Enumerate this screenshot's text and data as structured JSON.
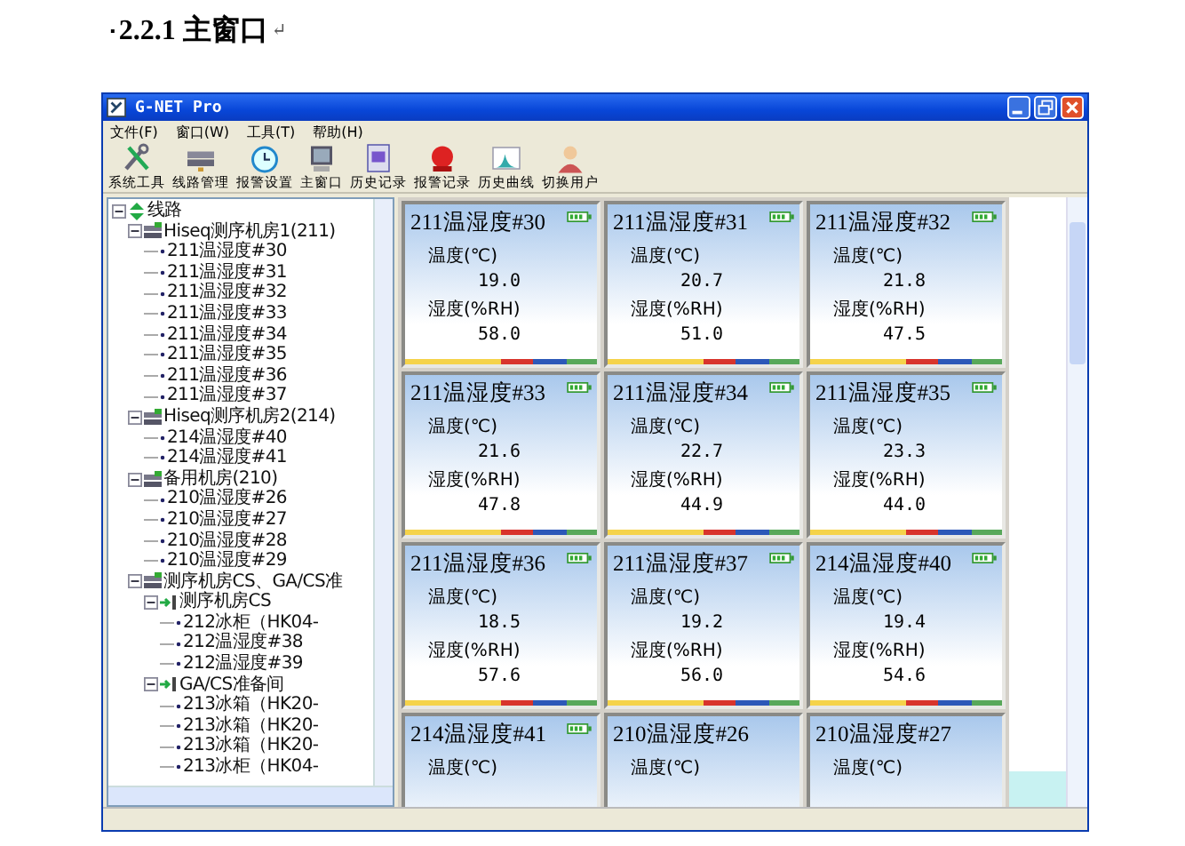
{
  "heading": {
    "marker": "▪",
    "text": "2.2.1 主窗口",
    "paragraph_mark": "↵"
  },
  "window": {
    "title": "G-NET Pro"
  },
  "menu": [
    "文件(F)",
    "窗口(W)",
    "工具(T)",
    "帮助(H)"
  ],
  "toolbar": [
    {
      "label": "系统工具",
      "kind": "tools"
    },
    {
      "label": "线路管理",
      "kind": "lines"
    },
    {
      "label": "报警设置",
      "kind": "clock"
    },
    {
      "label": "主窗口",
      "kind": "monitor"
    },
    {
      "label": "历史记录",
      "kind": "document"
    },
    {
      "label": "报警记录",
      "kind": "alarm"
    },
    {
      "label": "历史曲线",
      "kind": "chart"
    },
    {
      "label": "切换用户",
      "kind": "user"
    }
  ],
  "tree": [
    {
      "label": "线路",
      "kind": "root",
      "expanded": true,
      "children": [
        {
          "label": "Hiseq测序机房1(211)",
          "kind": "room",
          "expanded": true,
          "children": [
            {
              "label": "211温湿度#30",
              "kind": "sensor"
            },
            {
              "label": "211温湿度#31",
              "kind": "sensor"
            },
            {
              "label": "211温湿度#32",
              "kind": "sensor"
            },
            {
              "label": "211温湿度#33",
              "kind": "sensor"
            },
            {
              "label": "211温湿度#34",
              "kind": "sensor"
            },
            {
              "label": "211温湿度#35",
              "kind": "sensor"
            },
            {
              "label": "211温湿度#36",
              "kind": "sensor"
            },
            {
              "label": "211温湿度#37",
              "kind": "sensor"
            }
          ]
        },
        {
          "label": "Hiseq测序机房2(214)",
          "kind": "room",
          "expanded": true,
          "children": [
            {
              "label": "214温湿度#40",
              "kind": "sensor"
            },
            {
              "label": "214温湿度#41",
              "kind": "sensor"
            }
          ]
        },
        {
          "label": "备用机房(210)",
          "kind": "room",
          "expanded": true,
          "children": [
            {
              "label": "210温湿度#26",
              "kind": "sensor"
            },
            {
              "label": "210温湿度#27",
              "kind": "sensor"
            },
            {
              "label": "210温湿度#28",
              "kind": "sensor"
            },
            {
              "label": "210温湿度#29",
              "kind": "sensor"
            }
          ]
        },
        {
          "label": "测序机房CS、GA/CS准",
          "kind": "room",
          "expanded": true,
          "children": [
            {
              "label": "测序机房CS",
              "kind": "zone",
              "expanded": true,
              "children": [
                {
                  "label": "212冰柜（HK04-",
                  "kind": "sensor"
                },
                {
                  "label": "212温湿度#38",
                  "kind": "sensor"
                },
                {
                  "label": "212温湿度#39",
                  "kind": "sensor"
                }
              ]
            },
            {
              "label": "GA/CS准备间",
              "kind": "zone",
              "expanded": true,
              "children": [
                {
                  "label": "213冰箱（HK20-",
                  "kind": "sensor"
                },
                {
                  "label": "213冰箱（HK20-",
                  "kind": "sensor"
                },
                {
                  "label": "213冰箱（HK20-",
                  "kind": "sensor"
                },
                {
                  "label": "213冰柜（HK04-",
                  "kind": "sensor"
                }
              ]
            }
          ]
        }
      ]
    }
  ],
  "cards": [
    {
      "title": "211温湿度#30",
      "battery": true,
      "temp_label": "温度(℃)",
      "temp": "19.0",
      "hum_label": "湿度(%RH)",
      "hum": "58.0"
    },
    {
      "title": "211温湿度#31",
      "battery": true,
      "temp_label": "温度(℃)",
      "temp": "20.7",
      "hum_label": "湿度(%RH)",
      "hum": "51.0"
    },
    {
      "title": "211温湿度#32",
      "battery": true,
      "temp_label": "温度(℃)",
      "temp": "21.8",
      "hum_label": "湿度(%RH)",
      "hum": "47.5"
    },
    {
      "title": "211温湿度#33",
      "battery": true,
      "temp_label": "温度(℃)",
      "temp": "21.6",
      "hum_label": "湿度(%RH)",
      "hum": "47.8"
    },
    {
      "title": "211温湿度#34",
      "battery": true,
      "temp_label": "温度(℃)",
      "temp": "22.7",
      "hum_label": "湿度(%RH)",
      "hum": "44.9"
    },
    {
      "title": "211温湿度#35",
      "battery": true,
      "temp_label": "温度(℃)",
      "temp": "23.3",
      "hum_label": "湿度(%RH)",
      "hum": "44.0"
    },
    {
      "title": "211温湿度#36",
      "battery": true,
      "temp_label": "温度(℃)",
      "temp": "18.5",
      "hum_label": "湿度(%RH)",
      "hum": "57.6"
    },
    {
      "title": "211温湿度#37",
      "battery": true,
      "temp_label": "温度(℃)",
      "temp": "19.2",
      "hum_label": "湿度(%RH)",
      "hum": "56.0"
    },
    {
      "title": "214温湿度#40",
      "battery": true,
      "temp_label": "温度(℃)",
      "temp": "19.4",
      "hum_label": "湿度(%RH)",
      "hum": "54.6"
    },
    {
      "title": "214温湿度#41",
      "battery": true,
      "temp_label": "温度(℃)"
    },
    {
      "title": "210温湿度#26",
      "battery": false,
      "temp_label": "温度(℃)"
    },
    {
      "title": "210温湿度#27",
      "battery": false,
      "temp_label": "温度(℃)"
    }
  ]
}
